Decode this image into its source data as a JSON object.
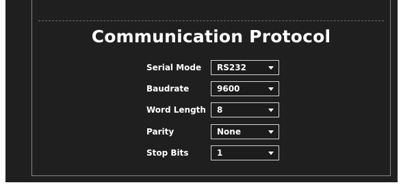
{
  "section": {
    "title": "Communication Protocol"
  },
  "fields": [
    {
      "label": "Serial Mode",
      "value": "RS232"
    },
    {
      "label": "Baudrate",
      "value": "9600"
    },
    {
      "label": "Word Length",
      "value": "8"
    },
    {
      "label": "Parity",
      "value": "None"
    },
    {
      "label": "Stop Bits",
      "value": "1"
    }
  ],
  "icons": {
    "dropdown": "chevron-down-icon"
  },
  "colors": {
    "background": "#1f1f1f",
    "text": "#ffffff",
    "select_border": "#d6d6d6",
    "panel_border": "#8a8a8a"
  }
}
